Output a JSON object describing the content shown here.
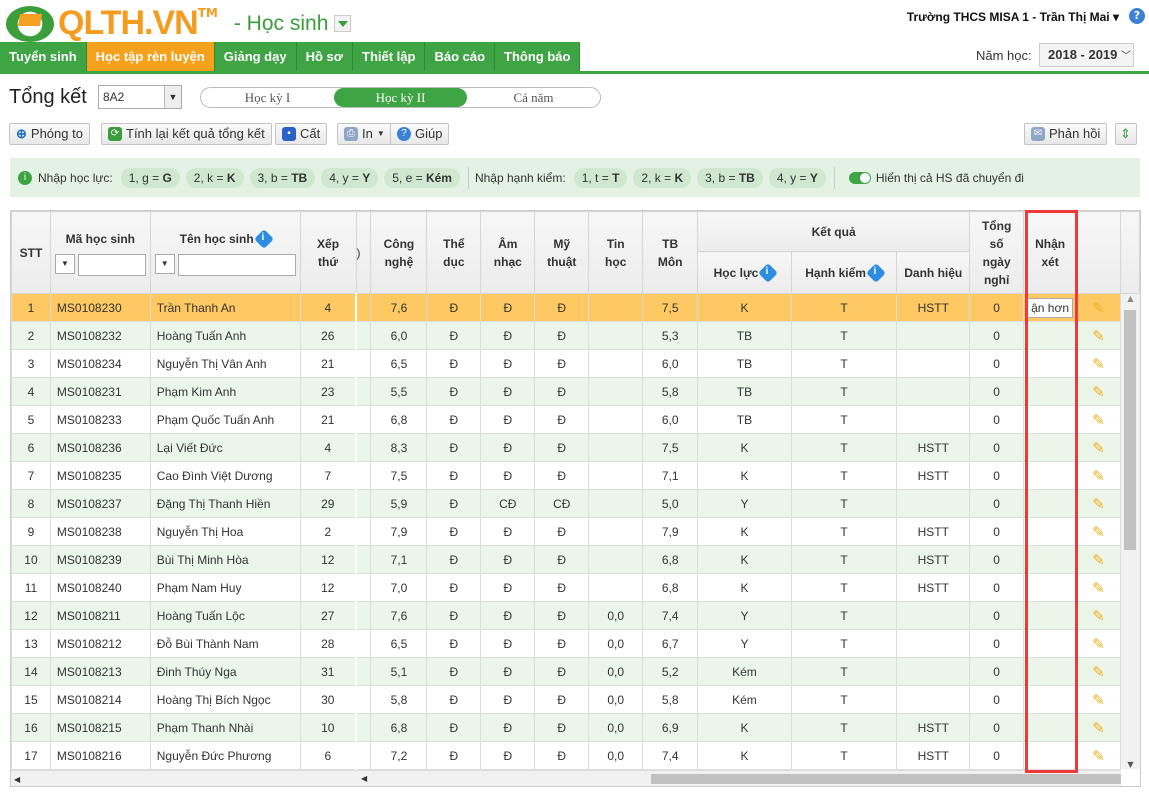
{
  "header": {
    "logo": "QLTH.VN",
    "tm": "TM",
    "module": "- Học sinh",
    "user": "Trường THCS MISA 1 - Trần Thị Mai"
  },
  "nav": [
    "Tuyển sinh",
    "Học tập rèn luyện",
    "Giảng dạy",
    "Hồ sơ",
    "Thiết lập",
    "Báo cáo",
    "Thông báo"
  ],
  "year": {
    "label": "Năm học:",
    "value": "2018 - 2019"
  },
  "page": {
    "title": "Tổng kết",
    "class": "8A2",
    "tabs": [
      "Học kỳ I",
      "Học kỳ II",
      "Cả năm"
    ],
    "active_tab": 1
  },
  "toolbar": {
    "zoom": "Phóng to",
    "recalc": "Tính lại kết quả tổng kết",
    "save": "Cất",
    "print": "In",
    "help": "Giúp",
    "feedback": "Phản hồi"
  },
  "legend": {
    "hl_label": "Nhập học lực:",
    "hl": [
      [
        "1, g = ",
        "G"
      ],
      [
        "2, k = ",
        "K"
      ],
      [
        "3, b = ",
        "TB"
      ],
      [
        "4, y = ",
        "Y"
      ],
      [
        "5, e = ",
        "Kém"
      ]
    ],
    "hk_label": "Nhập hạnh kiểm:",
    "hk": [
      [
        "1, t = ",
        "T"
      ],
      [
        "2, k = ",
        "K"
      ],
      [
        "3, b = ",
        "TB"
      ],
      [
        "4, y = ",
        "Y"
      ]
    ],
    "toggle": "Hiển thị cả HS đã chuyển đi"
  },
  "columns": {
    "stt": "STT",
    "ma": "Mã học sinh",
    "ten": "Tên học sinh",
    "xep": "Xếp thứ",
    "cut": ")",
    "cn": "Công nghệ",
    "td": "Thể dục",
    "an": "Âm nhạc",
    "mt": "Mỹ thuật",
    "th": "Tin học",
    "tb": "TB Môn",
    "kq": "Kết quả",
    "hl": "Học lực",
    "hk": "Hạnh kiểm",
    "dh": "Danh hiệu",
    "nghi": "Tổng số ngày nghỉ",
    "nx": "Nhận xét"
  },
  "editing_value": "ận hơn",
  "rows": [
    [
      "1",
      "MS0108230",
      "Trần Thanh An",
      "4",
      "7,6",
      "Đ",
      "Đ",
      "Đ",
      "",
      "7,5",
      "K",
      "T",
      "HSTT",
      "0"
    ],
    [
      "2",
      "MS0108232",
      "Hoàng Tuấn Anh",
      "26",
      "6,0",
      "Đ",
      "Đ",
      "Đ",
      "",
      "5,3",
      "TB",
      "T",
      "",
      "0"
    ],
    [
      "3",
      "MS0108234",
      "Nguyễn Thị Vân Anh",
      "21",
      "6,5",
      "Đ",
      "Đ",
      "Đ",
      "",
      "6,0",
      "TB",
      "T",
      "",
      "0"
    ],
    [
      "4",
      "MS0108231",
      "Phạm Kim Anh",
      "23",
      "5,5",
      "Đ",
      "Đ",
      "Đ",
      "",
      "5,8",
      "TB",
      "T",
      "",
      "0"
    ],
    [
      "5",
      "MS0108233",
      "Phạm Quốc Tuấn Anh",
      "21",
      "6,8",
      "Đ",
      "Đ",
      "Đ",
      "",
      "6,0",
      "TB",
      "T",
      "",
      "0"
    ],
    [
      "6",
      "MS0108236",
      "Lại Viết Đức",
      "4",
      "8,3",
      "Đ",
      "Đ",
      "Đ",
      "",
      "7,5",
      "K",
      "T",
      "HSTT",
      "0"
    ],
    [
      "7",
      "MS0108235",
      "Cao Đình Việt Dương",
      "7",
      "7,5",
      "Đ",
      "Đ",
      "Đ",
      "",
      "7,1",
      "K",
      "T",
      "HSTT",
      "0"
    ],
    [
      "8",
      "MS0108237",
      "Đặng Thị Thanh Hiền",
      "29",
      "5,9",
      "Đ",
      "CĐ",
      "CĐ",
      "",
      "5,0",
      "Y",
      "T",
      "",
      "0"
    ],
    [
      "9",
      "MS0108238",
      "Nguyễn Thị Hoa",
      "2",
      "7,9",
      "Đ",
      "Đ",
      "Đ",
      "",
      "7,9",
      "K",
      "T",
      "HSTT",
      "0"
    ],
    [
      "10",
      "MS0108239",
      "Bùi Thị Minh Hòa",
      "12",
      "7,1",
      "Đ",
      "Đ",
      "Đ",
      "",
      "6,8",
      "K",
      "T",
      "HSTT",
      "0"
    ],
    [
      "11",
      "MS0108240",
      "Phạm Nam Huy",
      "12",
      "7,0",
      "Đ",
      "Đ",
      "Đ",
      "",
      "6,8",
      "K",
      "T",
      "HSTT",
      "0"
    ],
    [
      "12",
      "MS0108211",
      "Hoàng Tuấn Lộc",
      "27",
      "7,6",
      "Đ",
      "Đ",
      "Đ",
      "0,0",
      "7,4",
      "Y",
      "T",
      "",
      "0"
    ],
    [
      "13",
      "MS0108212",
      "Đỗ Bùi Thành Nam",
      "28",
      "6,5",
      "Đ",
      "Đ",
      "Đ",
      "0,0",
      "6,7",
      "Y",
      "T",
      "",
      "0"
    ],
    [
      "14",
      "MS0108213",
      "Đinh Thúy Nga",
      "31",
      "5,1",
      "Đ",
      "Đ",
      "Đ",
      "0,0",
      "5,2",
      "Kém",
      "T",
      "",
      "0"
    ],
    [
      "15",
      "MS0108214",
      "Hoàng Thị Bích Ngọc",
      "30",
      "5,8",
      "Đ",
      "Đ",
      "Đ",
      "0,0",
      "5,8",
      "Kém",
      "T",
      "",
      "0"
    ],
    [
      "16",
      "MS0108215",
      "Phạm Thanh Nhài",
      "10",
      "6,8",
      "Đ",
      "Đ",
      "Đ",
      "0,0",
      "6,9",
      "K",
      "T",
      "HSTT",
      "0"
    ],
    [
      "17",
      "MS0108216",
      "Nguyễn Đức Phương",
      "6",
      "7,2",
      "Đ",
      "Đ",
      "Đ",
      "0,0",
      "7,4",
      "K",
      "T",
      "HSTT",
      "0"
    ]
  ]
}
